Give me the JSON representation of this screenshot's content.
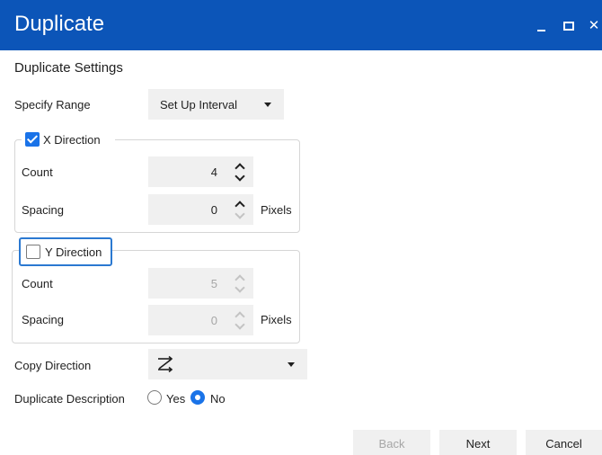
{
  "window": {
    "title": "Duplicate"
  },
  "settings": {
    "heading": "Duplicate Settings",
    "specify_range": {
      "label": "Specify Range",
      "value": "Set Up Interval"
    },
    "x_direction": {
      "label": "X Direction",
      "checked": true,
      "count": {
        "label": "Count",
        "value": "4"
      },
      "spacing": {
        "label": "Spacing",
        "value": "0",
        "unit": "Pixels"
      }
    },
    "y_direction": {
      "label": "Y Direction",
      "checked": false,
      "count": {
        "label": "Count",
        "value": "5"
      },
      "spacing": {
        "label": "Spacing",
        "value": "0",
        "unit": "Pixels"
      }
    },
    "copy_direction": {
      "label": "Copy Direction",
      "icon": "z-order-arrows-icon"
    },
    "duplicate_description": {
      "label": "Duplicate Description",
      "options": [
        "Yes",
        "No"
      ],
      "selected": "No"
    }
  },
  "buttons": {
    "back": "Back",
    "next": "Next",
    "cancel": "Cancel"
  },
  "colors": {
    "titlebar": "#0c55b8",
    "accent": "#1a73e8",
    "control_bg": "#f0f0f0",
    "disabled_text": "#a6a6a6"
  }
}
